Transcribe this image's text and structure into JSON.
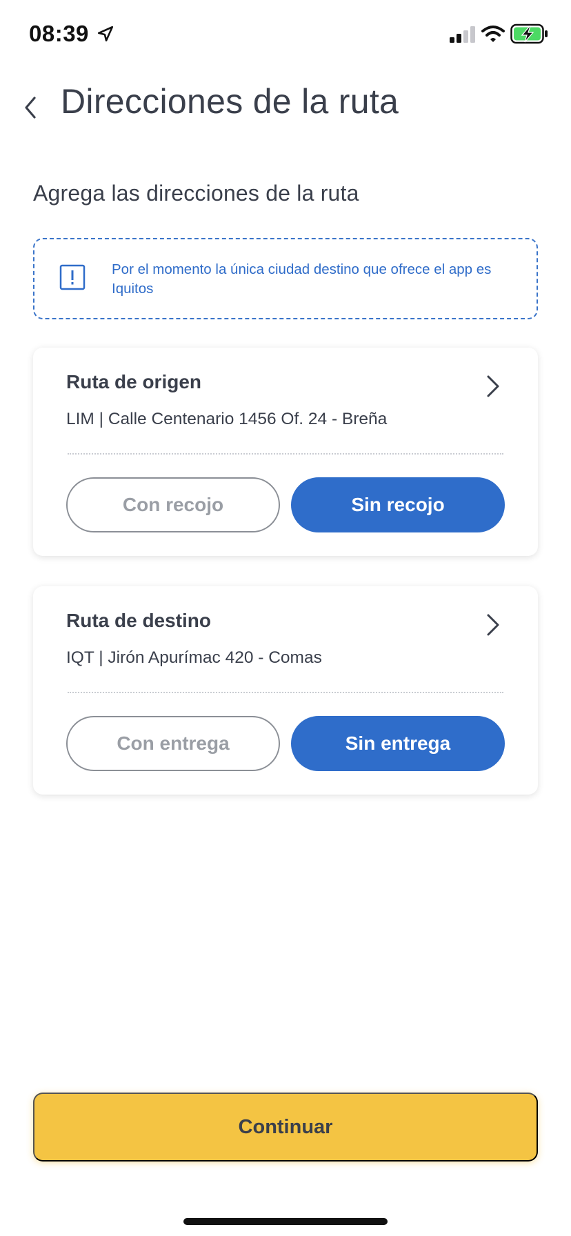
{
  "status_bar": {
    "time": "08:39",
    "icons": [
      "location-arrow-icon",
      "cellular-signal-icon",
      "wifi-icon",
      "battery-charging-icon"
    ],
    "battery_color": "#4cd964"
  },
  "header": {
    "title": "Direcciones de la ruta",
    "back_icon": "chevron-left-icon"
  },
  "main": {
    "section_title": "Agrega las direcciones de la ruta",
    "notice": {
      "icon": "exclamation-square-icon",
      "text": "Por el momento la única ciudad destino que ofrece el app es Iquitos"
    },
    "origin_card": {
      "title": "Ruta de origen",
      "address": "LIM | Calle Centenario 1456 Of. 24 - Breña",
      "option_outline": "Con recojo",
      "option_selected": "Sin recojo",
      "selected": "Sin recojo"
    },
    "destination_card": {
      "title": "Ruta de destino",
      "address": "IQT | Jirón Apurímac 420 - Comas",
      "option_outline": "Con entrega",
      "option_selected": "Sin entrega",
      "selected": "Sin entrega"
    }
  },
  "footer": {
    "continue_label": "Continuar"
  },
  "colors": {
    "primary_blue": "#2f6dca",
    "accent_yellow": "#f4c443",
    "text_dark": "#3a3f4b",
    "muted_gray": "#9a9ea5"
  }
}
